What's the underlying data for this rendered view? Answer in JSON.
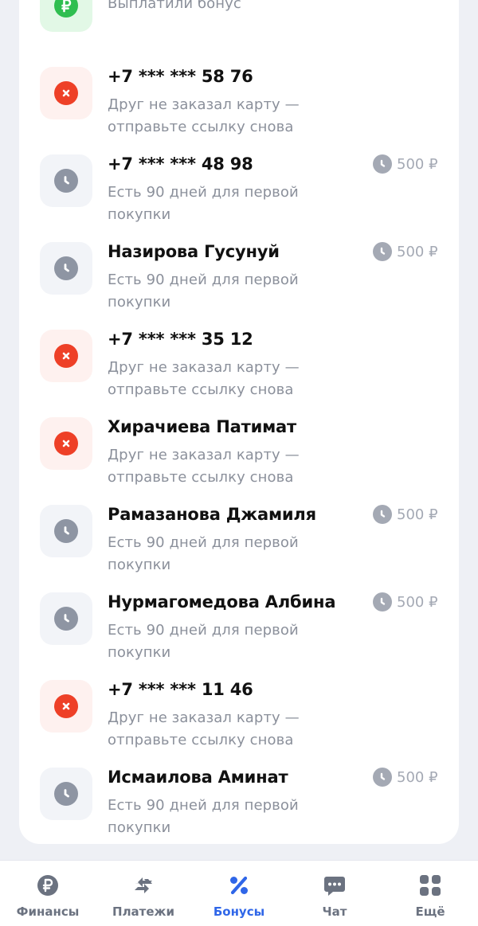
{
  "colors": {
    "accent": "#2f66e8",
    "fail": "#ee4027",
    "wait": "#8e95a3",
    "paid": "#2fbe50",
    "muted_text": "#8b909b"
  },
  "rows": [
    {
      "status": "paid",
      "icon": "ruble-icon",
      "name": "",
      "desc": "Выплатили бонус",
      "bonus": ""
    },
    {
      "status": "fail",
      "icon": "cross-icon",
      "name": "+7 *** *** 58 76",
      "desc": "Друг не заказал карту — отправьте ссылку снова",
      "bonus": ""
    },
    {
      "status": "wait",
      "icon": "clock-icon",
      "name": "+7 *** *** 48 98",
      "desc": "Есть 90 дней для первой покупки",
      "bonus": "500 ₽"
    },
    {
      "status": "wait",
      "icon": "clock-icon",
      "name": "Назирова Гусунуй",
      "desc": "Есть 90 дней для первой покупки",
      "bonus": "500 ₽"
    },
    {
      "status": "fail",
      "icon": "cross-icon",
      "name": "+7 *** *** 35 12",
      "desc": "Друг не заказал карту — отправьте ссылку снова",
      "bonus": ""
    },
    {
      "status": "fail",
      "icon": "cross-icon",
      "name": "Хирачиева Патимат",
      "desc": "Друг не заказал карту — отправьте ссылку снова",
      "bonus": ""
    },
    {
      "status": "wait",
      "icon": "clock-icon",
      "name": "Рамазанова Джамиля",
      "desc": "Есть 90 дней для первой покупки",
      "bonus": "500 ₽"
    },
    {
      "status": "wait",
      "icon": "clock-icon",
      "name": "Нурмагомедова Албина",
      "desc": "Есть 90 дней для первой покупки",
      "bonus": "500 ₽"
    },
    {
      "status": "fail",
      "icon": "cross-icon",
      "name": "+7 *** *** 11 46",
      "desc": "Друг не заказал карту — отправьте ссылку снова",
      "bonus": ""
    },
    {
      "status": "wait",
      "icon": "clock-icon",
      "name": "Исмаилова Аминат",
      "desc": "Есть 90 дней для первой покупки",
      "bonus": "500 ₽"
    }
  ],
  "tabbar": {
    "tabs": [
      {
        "id": "finances",
        "label": "Финансы",
        "icon": "ruble-circle-icon",
        "active": false
      },
      {
        "id": "payments",
        "label": "Платежи",
        "icon": "transfer-arrows-icon",
        "active": false
      },
      {
        "id": "bonuses",
        "label": "Бонусы",
        "icon": "percent-icon",
        "active": true
      },
      {
        "id": "chat",
        "label": "Чат",
        "icon": "chat-bubble-icon",
        "active": false
      },
      {
        "id": "more",
        "label": "Ещё",
        "icon": "grid-icon",
        "active": false
      }
    ]
  }
}
